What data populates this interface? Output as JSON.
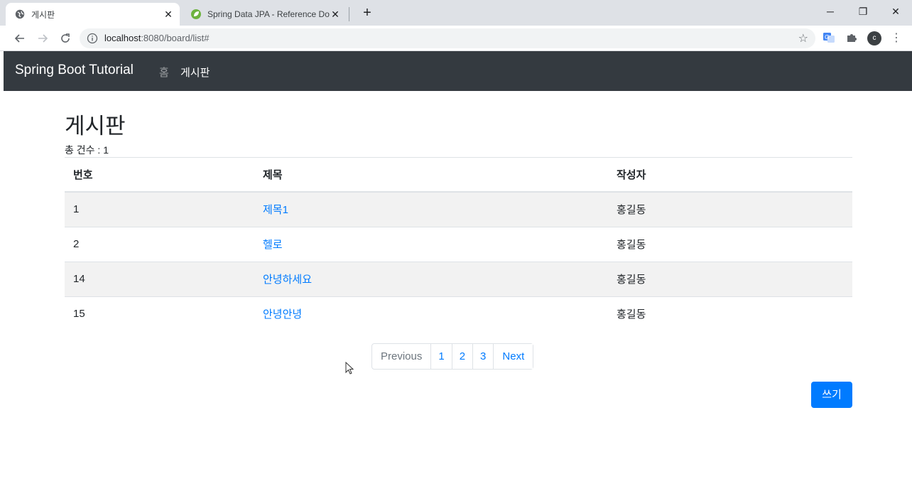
{
  "browser": {
    "tabs": [
      {
        "title": "게시판",
        "close": "✕",
        "favicon": "globe-icon"
      },
      {
        "title": "Spring Data JPA - Reference Do",
        "close": "✕",
        "favicon": "spring-leaf-icon"
      }
    ],
    "new_tab": "+",
    "window_controls": {
      "minimize": "─",
      "restore": "❐",
      "close": "✕"
    },
    "url_host": "localhost",
    "url_path": ":8080/board/list#",
    "profile_initial": "c"
  },
  "navbar": {
    "brand": "Spring Boot Tutorial",
    "links": [
      {
        "label": "홈",
        "active": false
      },
      {
        "label": "게시판",
        "active": true
      }
    ]
  },
  "main": {
    "title": "게시판",
    "count_text": "총 건수 : 1",
    "table": {
      "columns": [
        "번호",
        "제목",
        "작성자"
      ],
      "rows": [
        {
          "no": "1",
          "title": "제목1",
          "writer": "홍길동"
        },
        {
          "no": "2",
          "title": "헬로",
          "writer": "홍길동"
        },
        {
          "no": "14",
          "title": "안녕하세요",
          "writer": "홍길동"
        },
        {
          "no": "15",
          "title": "안녕안녕",
          "writer": "홍길동"
        }
      ]
    },
    "pagination": {
      "previous": "Previous",
      "pages": [
        "1",
        "2",
        "3"
      ],
      "next": "Next"
    },
    "write_button": "쓰기"
  },
  "colors": {
    "navbar_bg": "#343a40",
    "link": "#007bff",
    "primary_button": "#007bff",
    "striped_row": "#f2f2f2"
  }
}
